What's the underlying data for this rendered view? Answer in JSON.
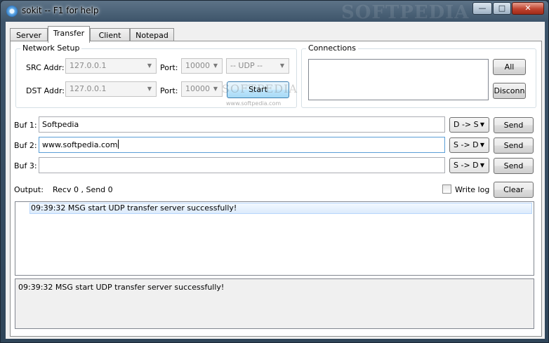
{
  "window": {
    "title": "sokit -- F1 for help",
    "watermark": "SOFTPEDIA",
    "controls": {
      "minimize": "—",
      "maximize": "□",
      "close": "✕"
    }
  },
  "tabs": [
    "Server",
    "Transfer",
    "Client",
    "Notepad"
  ],
  "active_tab": "Transfer",
  "network_setup": {
    "title": "Network Setup",
    "src_label": "SRC Addr:",
    "src_value": "127.0.0.1",
    "src_port_label": "Port:",
    "src_port_value": "10000",
    "protocol_value": "-- UDP --",
    "dst_label": "DST Addr:",
    "dst_value": "127.0.0.1",
    "dst_port_label": "Port:",
    "dst_port_value": "10000",
    "start_label": "Start"
  },
  "overlay_watermark": {
    "big": "SOFTPEDIA",
    "small": "www.softpedia.com"
  },
  "connections": {
    "title": "Connections",
    "all_label": "All",
    "disconn_label": "Disconn"
  },
  "buffers": [
    {
      "label": "Buf 1:",
      "value": "Softpedia",
      "direction": "D -> S",
      "send_label": "Send"
    },
    {
      "label": "Buf 2:",
      "value": "www.softpedia.com",
      "direction": "S -> D",
      "send_label": "Send"
    },
    {
      "label": "Buf 3:",
      "value": "",
      "direction": "S -> D",
      "send_label": "Send"
    }
  ],
  "output": {
    "label": "Output:",
    "stats": "Recv  0  , Send  0",
    "write_log_label": "Write log",
    "write_log_checked": false,
    "clear_label": "Clear",
    "log_lines": [
      "09:39:32 MSG start UDP transfer server successfully!"
    ],
    "status_text": "09:39:32 MSG start UDP transfer server successfully!"
  },
  "icons": {
    "app": "sokit-app-icon",
    "dropdown": "chevron-down-icon"
  }
}
